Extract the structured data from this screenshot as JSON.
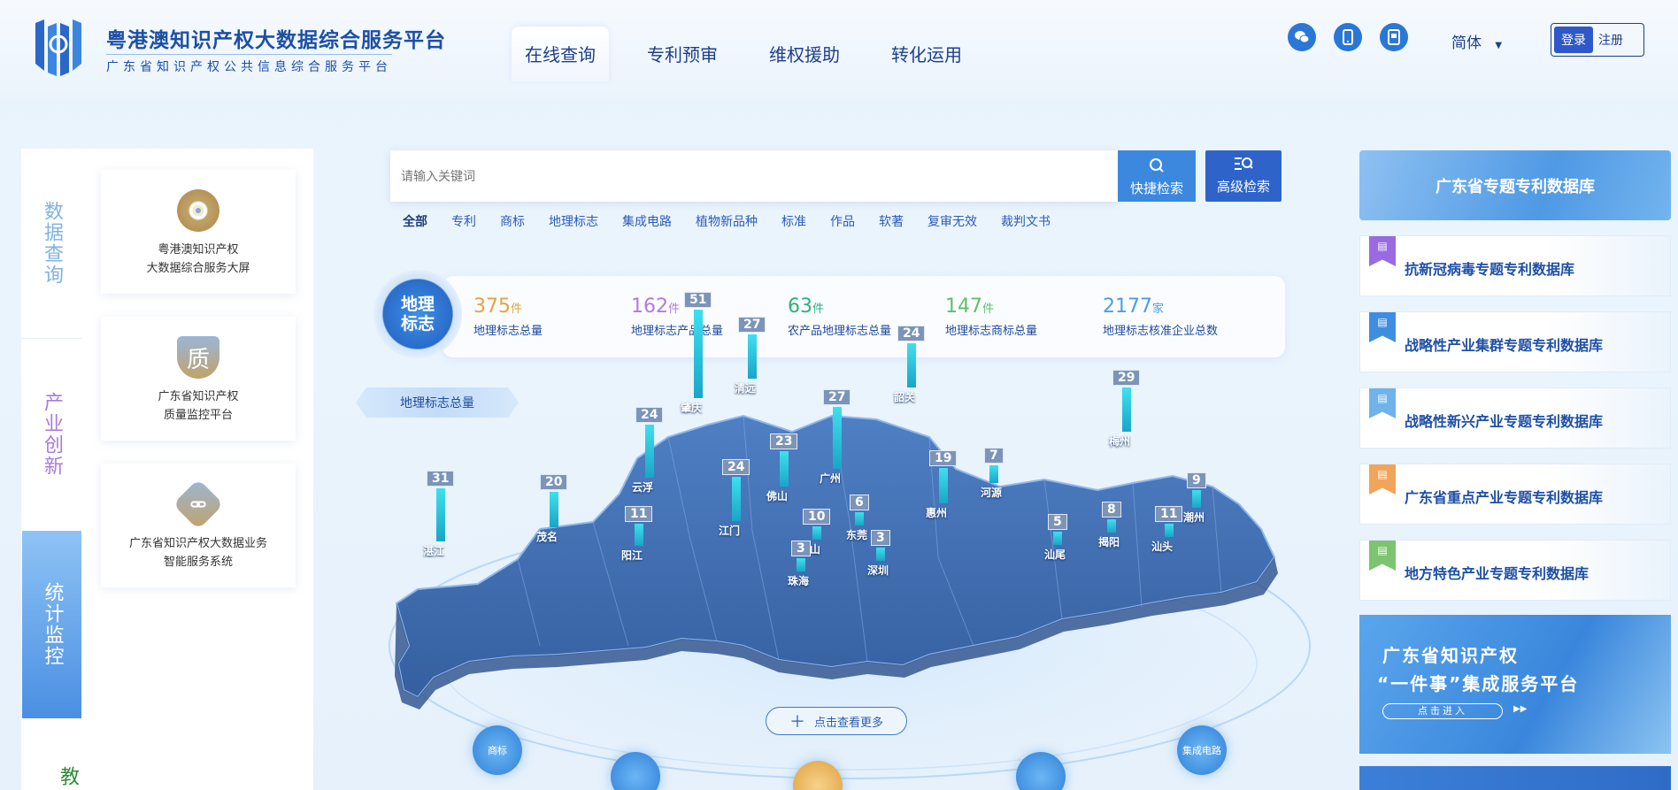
{
  "header": {
    "title": "粤港澳知识产权大数据综合服务平台",
    "subtitle": "广东省知识产权公共信息综合服务平台",
    "nav": [
      {
        "label": "在线查询",
        "active": true
      },
      {
        "label": "专利预审",
        "active": false
      },
      {
        "label": "维权援助",
        "active": false
      },
      {
        "label": "转化运用",
        "active": false
      }
    ],
    "icons": [
      "wechat-icon",
      "mobile-icon",
      "app-icon"
    ],
    "language": "简体",
    "login_label": "登录",
    "register_label": "注册"
  },
  "left_tabs": [
    {
      "label": "数据查询"
    },
    {
      "label": "产业创新"
    },
    {
      "label": "统计监控"
    },
    {
      "label": "教"
    }
  ],
  "services": [
    {
      "line1": "粤港澳知识产权",
      "line2": "大数据综合服务大屏",
      "icon": "gear-icon",
      "color": "#c0a36a"
    },
    {
      "line1": "广东省知识产权",
      "line2": "质量监控平台",
      "icon": "quality-icon",
      "glyph": "质",
      "color": "#c0a36a"
    },
    {
      "line1": "广东省知识产权大数据业务",
      "line2": "智能服务系统",
      "icon": "link-icon",
      "color": "#c0a36a"
    }
  ],
  "search": {
    "placeholder": "请输入关键词",
    "quick_label": "快捷检索",
    "advanced_label": "高级检索",
    "categories": [
      "全部",
      "专利",
      "商标",
      "地理标志",
      "集成电路",
      "植物新品种",
      "标准",
      "作品",
      "软著",
      "复审无效",
      "裁判文书"
    ]
  },
  "stats": {
    "badge": "地理标志",
    "items": [
      {
        "value": "375",
        "unit": "件",
        "label": "地理标志总量",
        "color": "#e2a440"
      },
      {
        "value": "162",
        "unit": "件",
        "label": "地理标志产品总量",
        "color": "#b07ce0"
      },
      {
        "value": "63",
        "unit": "件",
        "label": "农产品地理标志总量",
        "color": "#2eb07a"
      },
      {
        "value": "147",
        "unit": "件",
        "label": "地理标志商标总量",
        "color": "#5cc16a"
      },
      {
        "value": "2177",
        "unit": "家",
        "label": "地理标志核准企业总数",
        "color": "#4b9de6"
      }
    ]
  },
  "map": {
    "label": "地理标志总量",
    "more_label": "点击查看更多",
    "markers": [
      {
        "city": "湛江",
        "value": "31"
      },
      {
        "city": "茂名",
        "value": "20"
      },
      {
        "city": "阳江",
        "value": "11"
      },
      {
        "city": "云浮",
        "value": "24"
      },
      {
        "city": "肇庆",
        "value": "51"
      },
      {
        "city": "清远",
        "value": "27"
      },
      {
        "city": "江门",
        "value": "24"
      },
      {
        "city": "佛山",
        "value": "23"
      },
      {
        "city": "中山",
        "value": "10"
      },
      {
        "city": "珠海",
        "value": "3"
      },
      {
        "city": "广州",
        "value": "27"
      },
      {
        "city": "东莞",
        "value": "6"
      },
      {
        "city": "深圳",
        "value": "3"
      },
      {
        "city": "韶关",
        "value": "24"
      },
      {
        "city": "惠州",
        "value": "19"
      },
      {
        "city": "河源",
        "value": "7"
      },
      {
        "city": "汕尾",
        "value": "5"
      },
      {
        "city": "揭阳",
        "value": "8"
      },
      {
        "city": "汕头",
        "value": "11"
      },
      {
        "city": "梅州",
        "value": "29"
      },
      {
        "city": "潮州",
        "value": "9"
      }
    ],
    "bottom_icons": [
      {
        "label": "商标",
        "icon": "trademark-icon"
      },
      {
        "label": "",
        "icon": "patent-icon"
      },
      {
        "label": "",
        "icon": "copyright-icon"
      },
      {
        "label": "",
        "icon": "plant-icon"
      },
      {
        "label": "集成电路",
        "icon": "chip-icon"
      }
    ]
  },
  "right_panel": {
    "header": "广东省专题专利数据库",
    "databases": [
      {
        "label": "抗新冠病毒专题专利数据库",
        "color": "#9a6be0"
      },
      {
        "label": "战略性产业集群专题专利数据库",
        "color": "#3f8de0"
      },
      {
        "label": "战略性新兴产业专题专利数据库",
        "color": "#6fb3ea"
      },
      {
        "label": "广东省重点产业专题专利数据库",
        "color": "#f0a55a"
      },
      {
        "label": "地方特色产业专题专利数据库",
        "color": "#7cc46f"
      }
    ],
    "promo_line1": "广东省知识产权",
    "promo_line2": "“一件事”集成服务平台",
    "promo_button": "点击进入"
  }
}
